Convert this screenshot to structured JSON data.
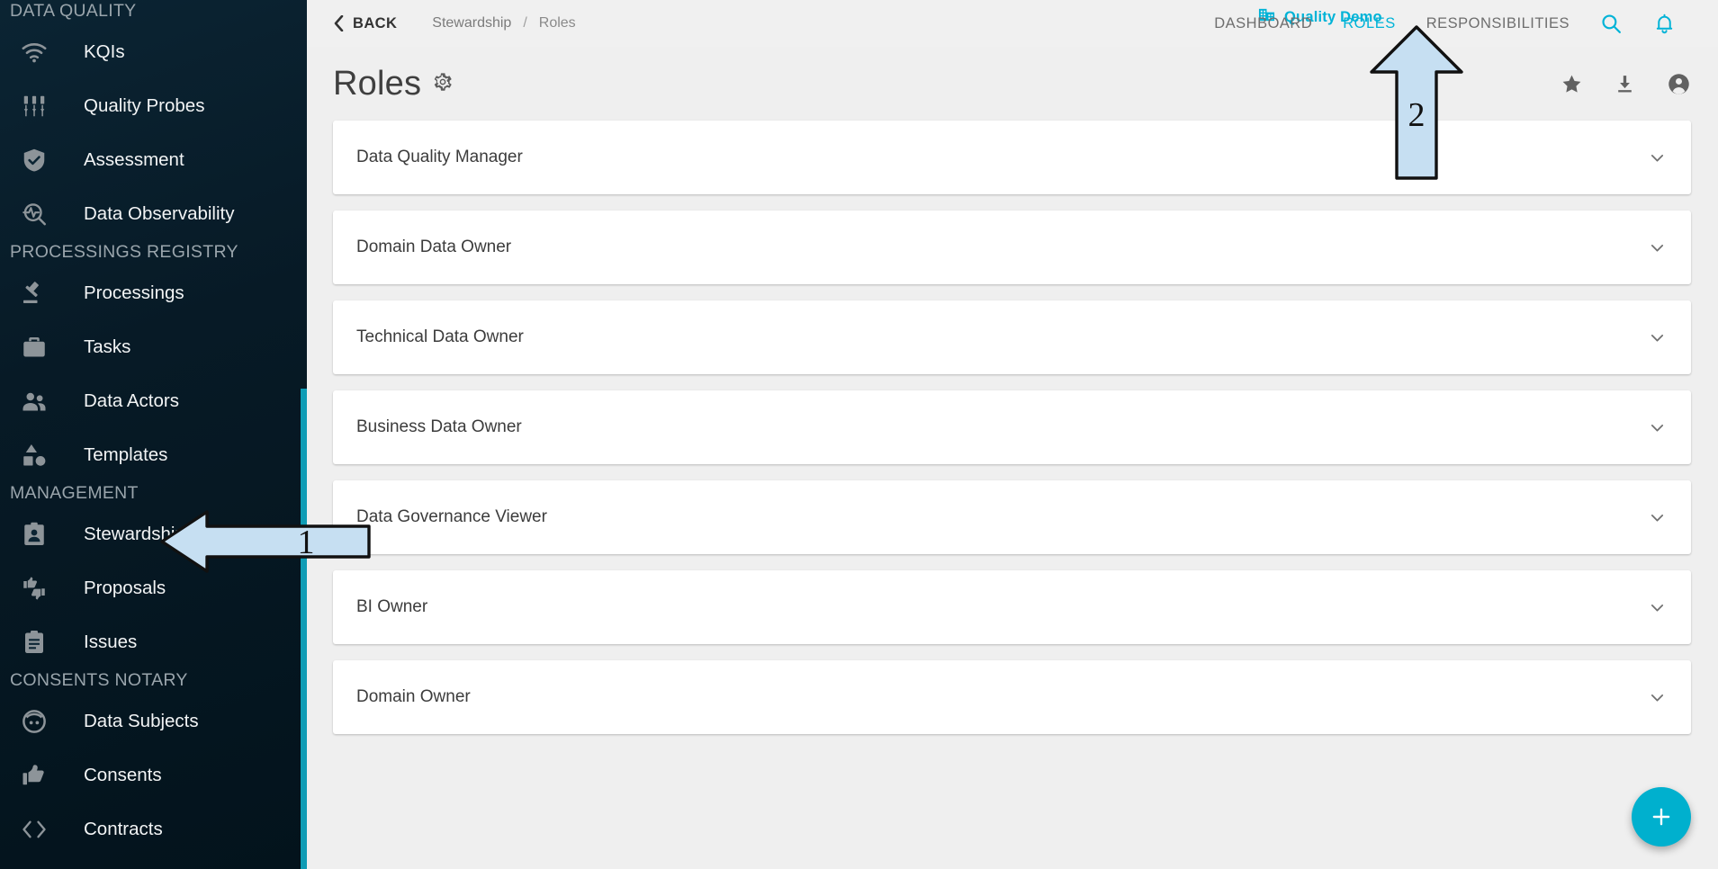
{
  "sidebar": {
    "groups": [
      {
        "title": "DATA QUALITY",
        "items": [
          {
            "label": "KQIs",
            "icon": "signal-icon"
          },
          {
            "label": "Quality Probes",
            "icon": "sliders-icon"
          },
          {
            "label": "Assessment",
            "icon": "shield-check-icon"
          },
          {
            "label": "Data Observability",
            "icon": "search-pulse-icon"
          }
        ]
      },
      {
        "title": "PROCESSINGS REGISTRY",
        "items": [
          {
            "label": "Processings",
            "icon": "gavel-icon"
          },
          {
            "label": "Tasks",
            "icon": "briefcase-icon"
          },
          {
            "label": "Data Actors",
            "icon": "people-icon"
          },
          {
            "label": "Templates",
            "icon": "shapes-icon"
          }
        ]
      },
      {
        "title": "MANAGEMENT",
        "items": [
          {
            "label": "Stewardship",
            "icon": "badge-icon"
          },
          {
            "label": "Proposals",
            "icon": "thumbs-updown-icon"
          },
          {
            "label": "Issues",
            "icon": "clipboard-icon"
          }
        ]
      },
      {
        "title": "CONSENTS NOTARY",
        "items": [
          {
            "label": "Data Subjects",
            "icon": "face-icon"
          },
          {
            "label": "Consents",
            "icon": "thumb-up-icon"
          },
          {
            "label": "Contracts",
            "icon": "code-brackets-icon"
          }
        ]
      }
    ]
  },
  "header": {
    "back_label": "BACK",
    "breadcrumb": {
      "parent": "Stewardship",
      "separator": "/",
      "current": "Roles"
    },
    "tenant": {
      "label": "Quality Demo",
      "icon": "building-icon"
    },
    "nav": [
      {
        "label": "DASHBOARD",
        "active": false
      },
      {
        "label": "ROLES",
        "active": true
      },
      {
        "label": "RESPONSIBILITIES",
        "active": false
      }
    ],
    "icons": [
      {
        "name": "search-icon"
      },
      {
        "name": "bell-icon"
      }
    ]
  },
  "main": {
    "title": "Roles",
    "title_gear_icon": "gear-icon",
    "actions": [
      {
        "name": "favorite-icon"
      },
      {
        "name": "download-icon"
      },
      {
        "name": "account-icon"
      }
    ],
    "roles": [
      {
        "name": "Data Quality Manager"
      },
      {
        "name": "Domain Data Owner"
      },
      {
        "name": "Technical Data Owner"
      },
      {
        "name": "Business Data Owner"
      },
      {
        "name": "Data Governance Viewer"
      },
      {
        "name": "BI Owner"
      },
      {
        "name": "Domain Owner"
      }
    ],
    "fab": {
      "label": "+",
      "icon": "plus-icon"
    }
  },
  "annotations": [
    {
      "number": "1",
      "direction": "left"
    },
    {
      "number": "2",
      "direction": "up"
    }
  ],
  "colors": {
    "accent": "#00b3d7",
    "sidebar_bg": "#071a26",
    "sidebar_accent": "#0f9cb5",
    "page_bg": "#efefef",
    "card_bg": "#ffffff",
    "annotation_fill": "#c6dff2"
  }
}
